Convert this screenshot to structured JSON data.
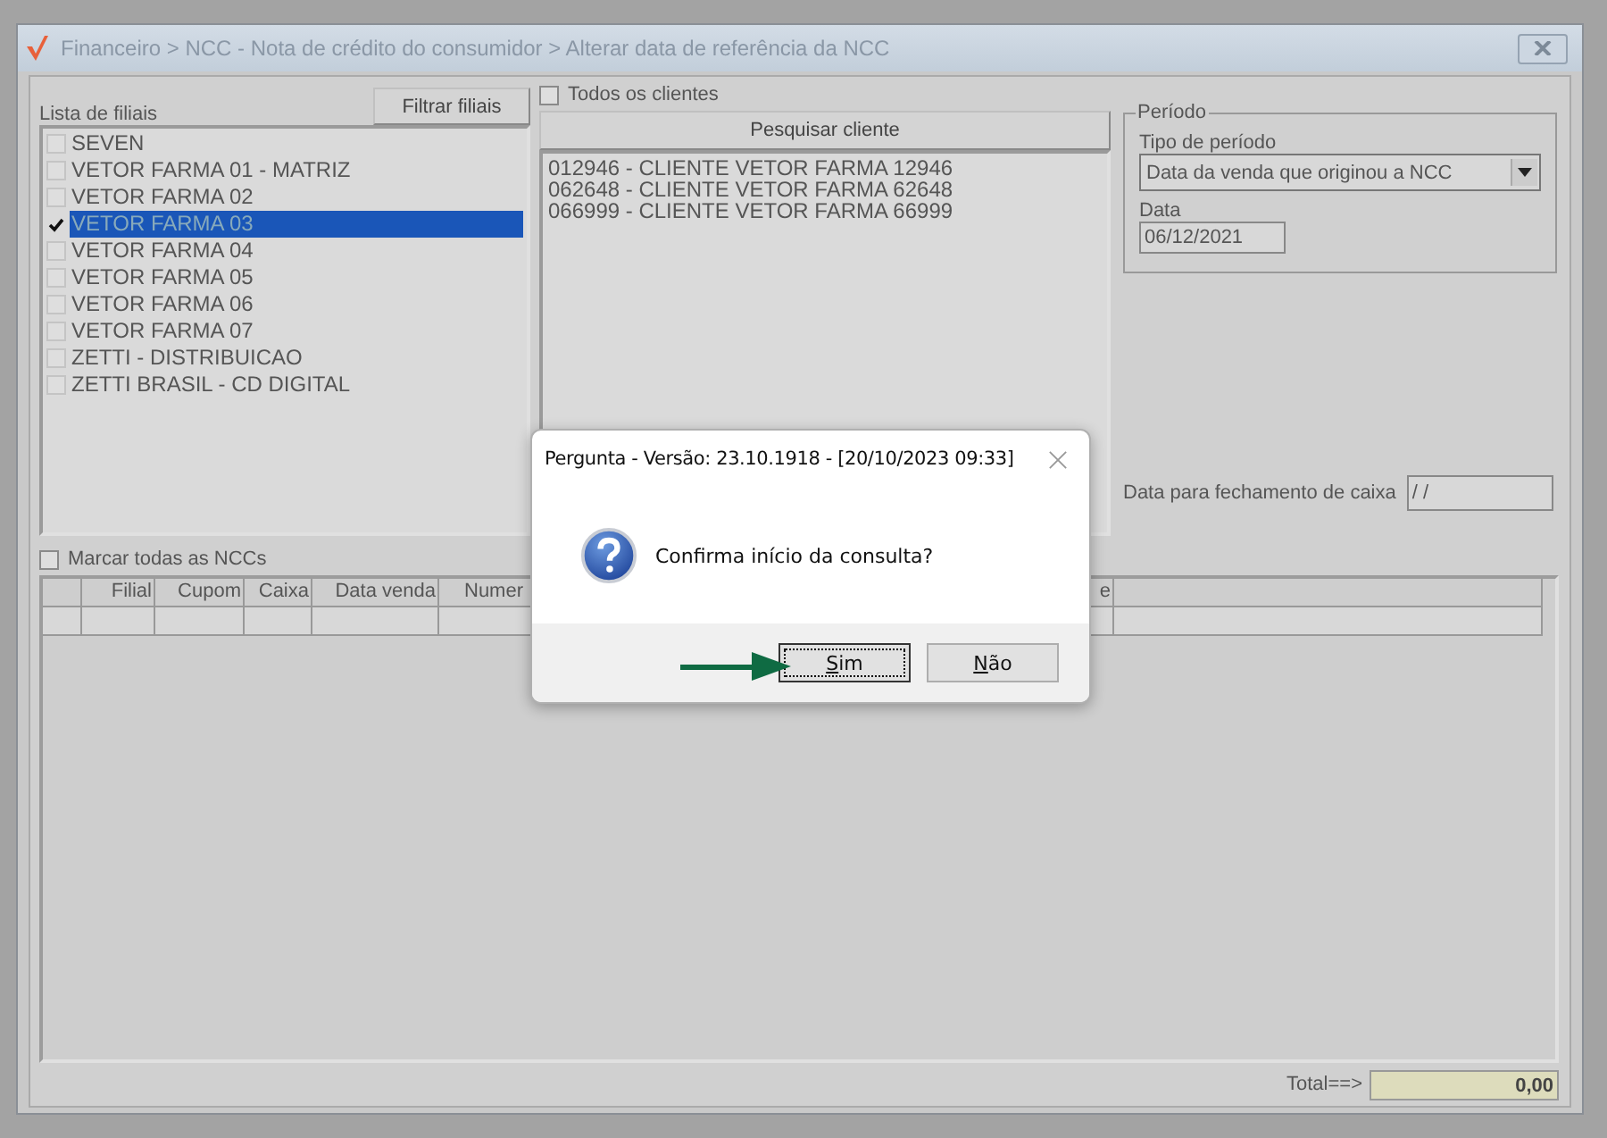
{
  "window": {
    "title": "Financeiro > NCC - Nota de crédito do consumidor > Alterar data de referência da NCC"
  },
  "branches": {
    "label": "Lista de filiais",
    "filter_button": "Filtrar filiais",
    "items": [
      {
        "label": "SEVEN",
        "checked": false,
        "selected": false
      },
      {
        "label": "VETOR FARMA 01 - MATRIZ",
        "checked": false,
        "selected": false
      },
      {
        "label": "VETOR FARMA 02",
        "checked": false,
        "selected": false
      },
      {
        "label": "VETOR FARMA 03",
        "checked": true,
        "selected": true
      },
      {
        "label": "VETOR FARMA 04",
        "checked": false,
        "selected": false
      },
      {
        "label": "VETOR FARMA 05",
        "checked": false,
        "selected": false
      },
      {
        "label": "VETOR FARMA 06",
        "checked": false,
        "selected": false
      },
      {
        "label": "VETOR FARMA 07",
        "checked": false,
        "selected": false
      },
      {
        "label": "ZETTI - DISTRIBUICAO",
        "checked": false,
        "selected": false
      },
      {
        "label": "ZETTI BRASIL - CD DIGITAL",
        "checked": false,
        "selected": false
      }
    ]
  },
  "clients": {
    "all_clients": {
      "label": "Todos os clientes",
      "checked": false
    },
    "search_button": "Pesquisar cliente",
    "items": [
      "012946 - CLIENTE VETOR FARMA 12946",
      "062648 - CLIENTE VETOR FARMA 62648",
      "066999 - CLIENTE VETOR FARMA 66999"
    ]
  },
  "period": {
    "legend": "Período",
    "type_label": "Tipo de período",
    "type_value": "Data da venda que originou a NCC",
    "date_label": "Data",
    "date_value": "06/12/2021"
  },
  "closing_date": {
    "label": "Data para fechamento de caixa",
    "value": "/ /"
  },
  "mark_all": {
    "label": "Marcar todas as NCCs",
    "checked": false
  },
  "grid": {
    "columns": [
      "Filial",
      "Cupom",
      "Caixa",
      "Data venda",
      "Numer",
      "e"
    ]
  },
  "total": {
    "label": "Total==>",
    "value": "0,00"
  },
  "dialog": {
    "title": "Pergunta - Versão: 23.10.1918 - [20/10/2023 09:33]",
    "message": "Confirma início da consulta?",
    "buttons": [
      {
        "label": "Sim",
        "focused": true,
        "access_key_underlined": true
      },
      {
        "label": "Não",
        "focused": false,
        "access_key_underlined": true
      }
    ]
  }
}
